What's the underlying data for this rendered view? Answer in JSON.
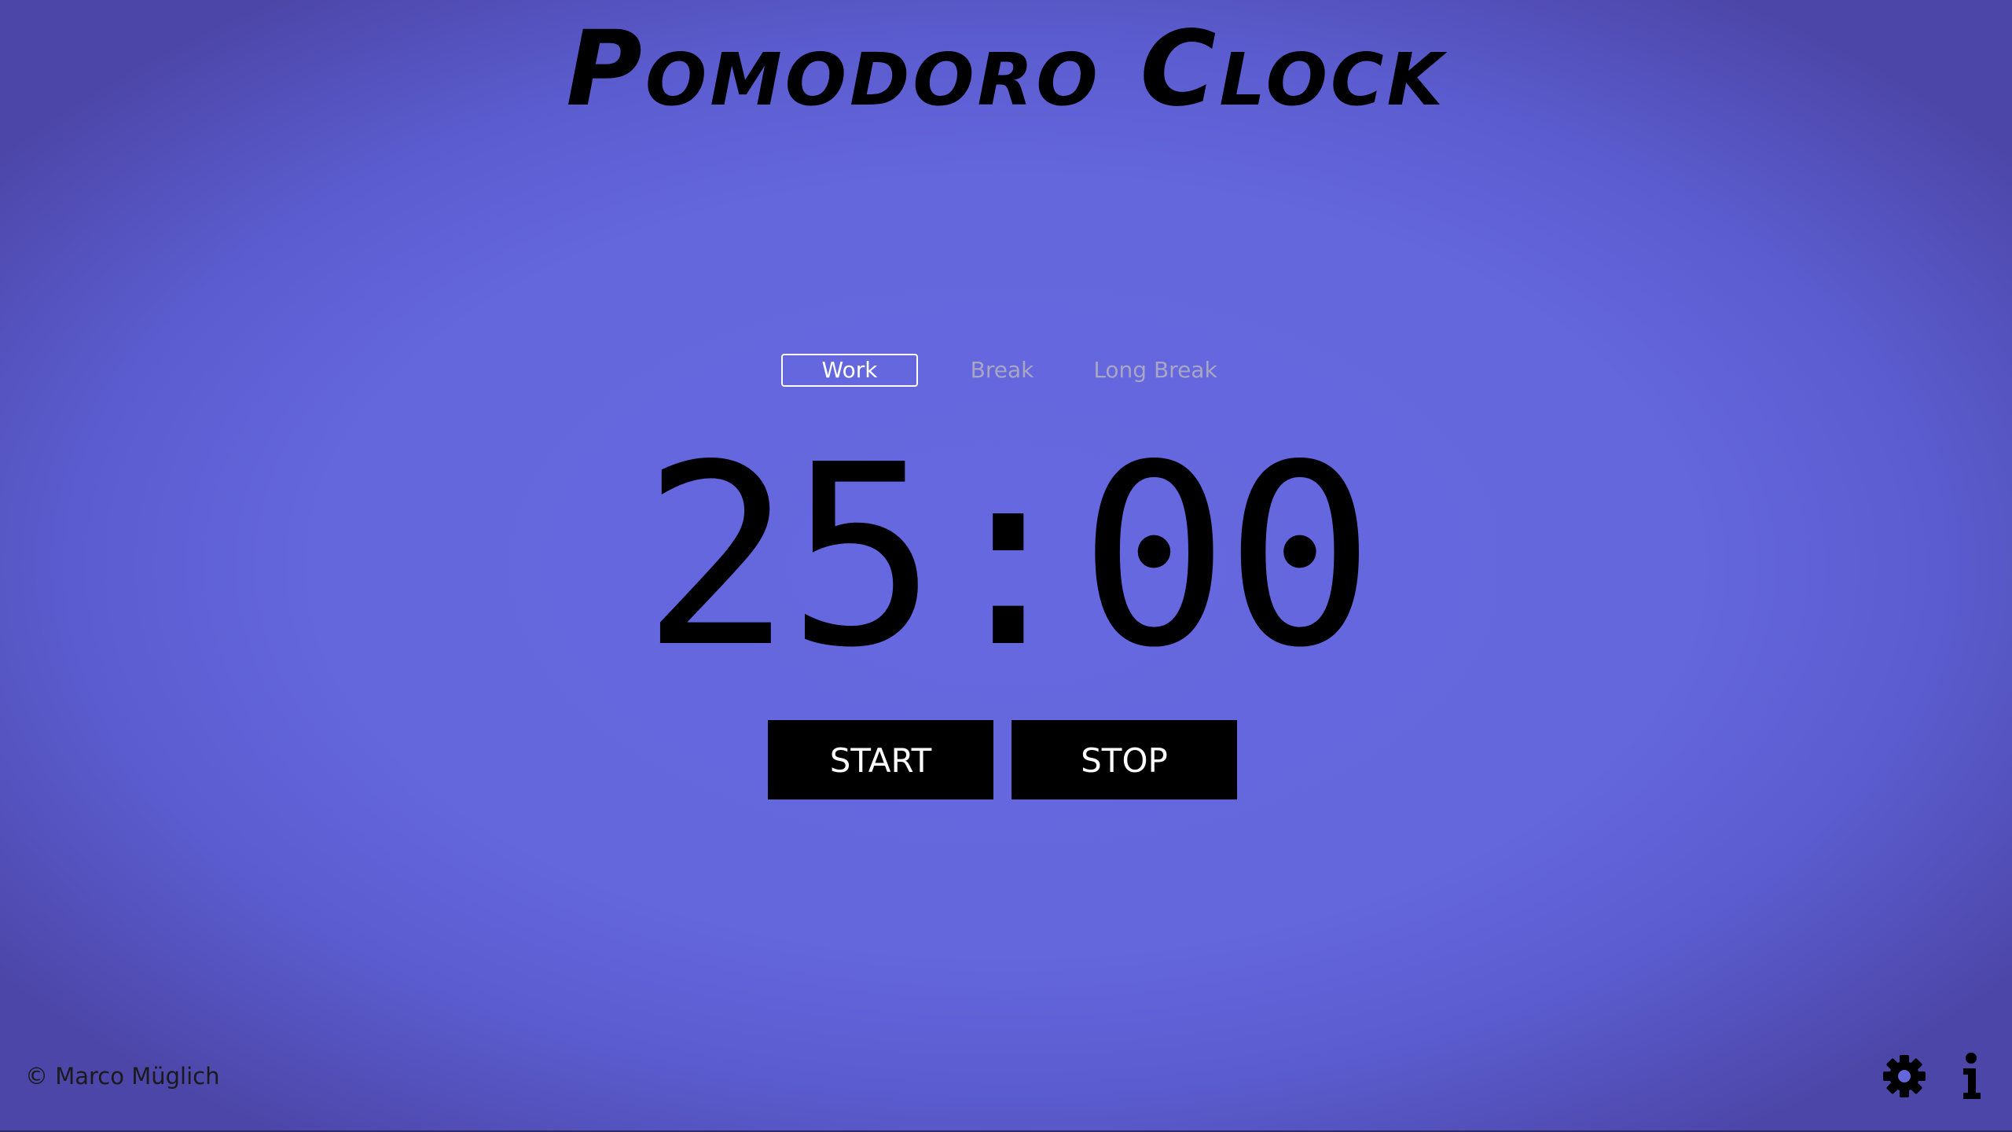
{
  "app": {
    "title": "Pomodoro Clock"
  },
  "tabs": [
    {
      "label": "Work",
      "active": true
    },
    {
      "label": "Break",
      "active": false
    },
    {
      "label": "Long Break",
      "active": false
    }
  ],
  "timer": {
    "display": "25:00"
  },
  "controls": {
    "start_label": "START",
    "stop_label": "STOP"
  },
  "footer": {
    "copyright": "© Marco Müglich",
    "icons": [
      "gear-icon",
      "info-icon"
    ]
  },
  "colors": {
    "background_center": "#6568de",
    "background_edge": "#4c46a8",
    "button_bg": "#000000",
    "button_text": "#ffffff",
    "active_tab": "#ffffff",
    "inactive_tab": "#a9a6c4"
  }
}
